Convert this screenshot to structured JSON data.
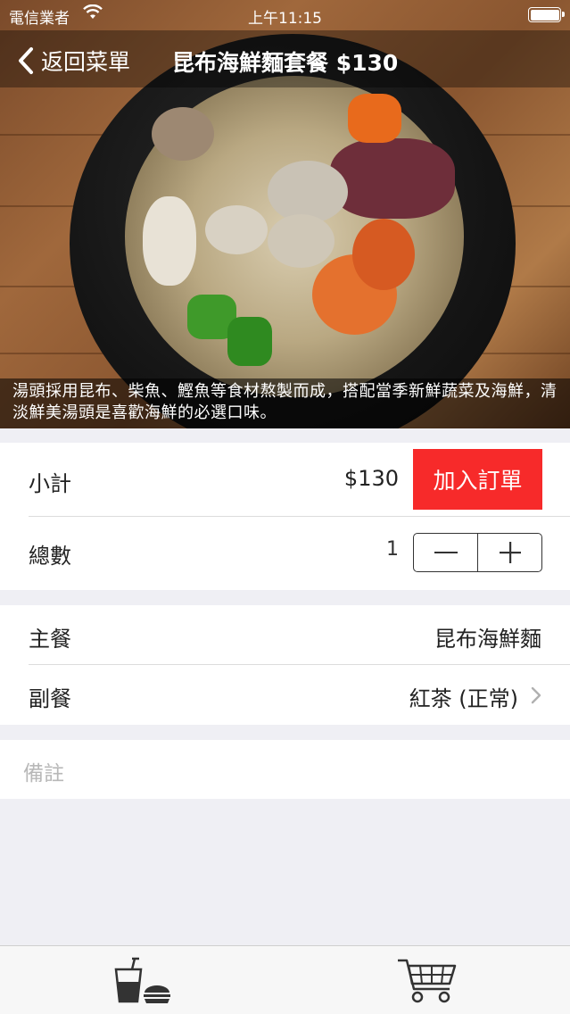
{
  "status_bar": {
    "carrier": "電信業者",
    "time": "上午11:15"
  },
  "nav": {
    "back_label": "返回菜單",
    "title": "昆布海鮮麵套餐 $130"
  },
  "hero": {
    "description": "湯頭採用昆布、柴魚、鰹魚等食材熬製而成，搭配當季新鮮蔬菜及海鮮，清淡鮮美湯頭是喜歡海鮮的必選口味。"
  },
  "order": {
    "subtotal_label": "小計",
    "subtotal_value": "$130",
    "add_button": "加入訂單",
    "quantity_label": "總數",
    "quantity_value": "1"
  },
  "options": {
    "main_label": "主餐",
    "main_value": "昆布海鮮麵",
    "side_label": "副餐",
    "side_value": "紅茶 (正常)"
  },
  "notes": {
    "placeholder": "備註"
  },
  "tabbar": {
    "items": [
      {
        "icon": "drink-burger-icon"
      },
      {
        "icon": "shopping-cart-icon"
      }
    ]
  },
  "colors": {
    "accent": "#f72a2a",
    "background": "#efeff4"
  }
}
